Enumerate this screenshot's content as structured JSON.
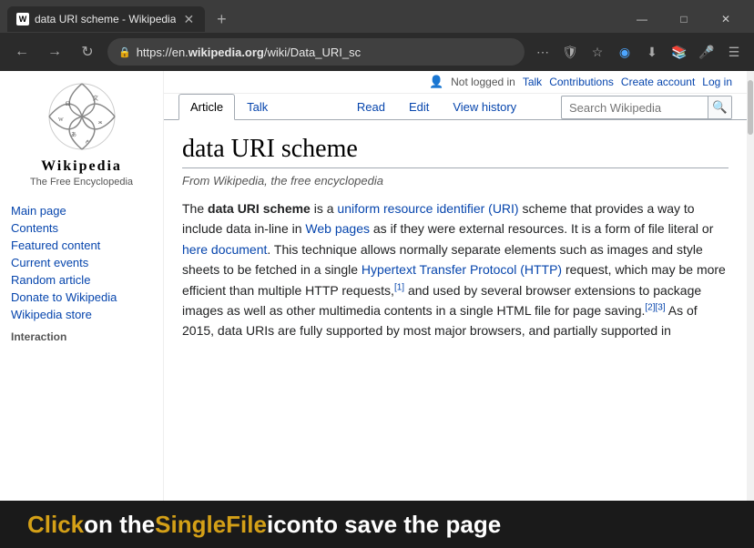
{
  "browser": {
    "tab_title": "data URI scheme - Wikipedia",
    "tab_favicon": "W",
    "new_tab_label": "+",
    "window_controls": {
      "minimize": "—",
      "maximize": "□",
      "close": "✕"
    },
    "nav": {
      "back": "←",
      "forward": "→"
    },
    "address": {
      "lock": "🔒",
      "url_display": "https://en.wikipedia.org/wiki/Data_URI_sc",
      "url_bold": "wikipedia.org"
    },
    "addr_icons": [
      "⋯",
      "⭐",
      "🔵",
      "⬇",
      "📚",
      "🎤",
      "☰"
    ]
  },
  "user_bar": {
    "icon": "👤",
    "not_logged_in": "Not logged in",
    "talk": "Talk",
    "contributions": "Contributions",
    "create_account": "Create account",
    "log_in": "Log in"
  },
  "page_tabs": {
    "article": "Article",
    "talk": "Talk",
    "read": "Read",
    "edit": "Edit",
    "view_history": "View history",
    "search_placeholder": "Search Wikipedia",
    "search_icon": "🔍"
  },
  "sidebar": {
    "wiki_name": "Wikipedia",
    "tagline": "The Free Encyclopedia",
    "nav_items": [
      {
        "label": "Main page",
        "id": "main-page"
      },
      {
        "label": "Contents",
        "id": "contents"
      },
      {
        "label": "Featured content",
        "id": "featured-content"
      },
      {
        "label": "Current events",
        "id": "current-events"
      },
      {
        "label": "Random article",
        "id": "random-article"
      },
      {
        "label": "Donate to Wikipedia",
        "id": "donate"
      },
      {
        "label": "Wikipedia store",
        "id": "store"
      }
    ],
    "interaction_label": "Interaction"
  },
  "article": {
    "title": "data URI scheme",
    "subtitle": "From Wikipedia, the free encyclopedia",
    "content": [
      {
        "type": "text",
        "value": "The "
      },
      {
        "type": "bold",
        "value": "data URI scheme"
      },
      {
        "type": "text",
        "value": " is a "
      },
      {
        "type": "link",
        "value": "uniform resource identifier (URI)"
      },
      {
        "type": "text",
        "value": " scheme that provides a way to include data in-line in "
      },
      {
        "type": "link",
        "value": "Web pages"
      },
      {
        "type": "text",
        "value": " as if they were external resources. It is a form of file literal or "
      },
      {
        "type": "link",
        "value": "here document"
      },
      {
        "type": "text",
        "value": ". This technique allows normally separate elements such as images and style sheets to be fetched in a single "
      },
      {
        "type": "link",
        "value": "Hypertext Transfer Protocol (HTTP)"
      },
      {
        "type": "text",
        "value": " request, which may be more efficient than multiple HTTP requests,"
      },
      {
        "type": "sup",
        "value": "[1]"
      },
      {
        "type": "text",
        "value": " and used by several browser extensions to package images as well as other multimedia contents in a single HTML file for page saving."
      },
      {
        "type": "sup",
        "value": "[2][3]"
      },
      {
        "type": "text",
        "value": " As of 2015, data URIs are fully supported by most major browsers, and partially supported in"
      }
    ]
  },
  "banner": {
    "click": "Click",
    "on_the": " on the ",
    "singlefile": "SingleFile",
    "icon": " icon",
    "to_save": " to save the page"
  }
}
